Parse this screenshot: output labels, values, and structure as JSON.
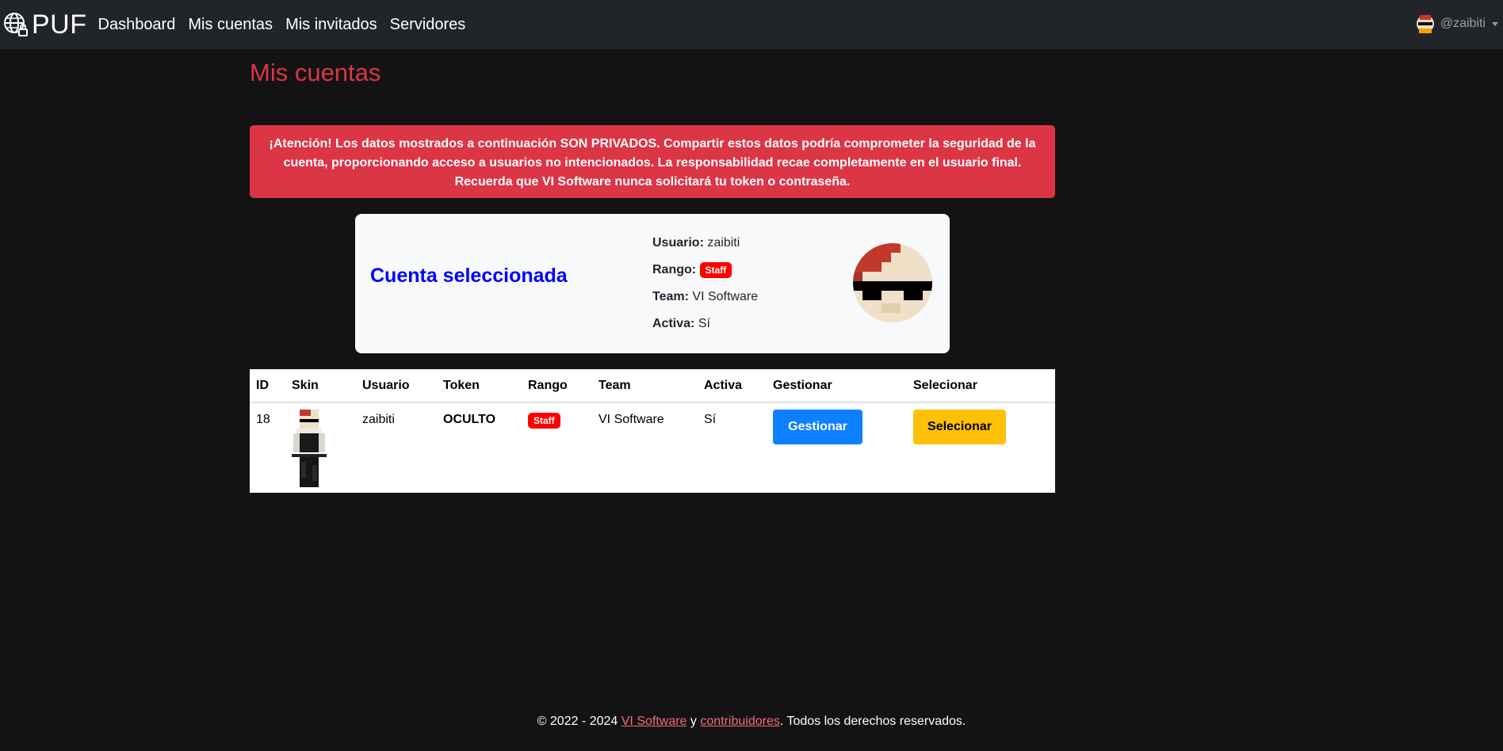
{
  "navbar": {
    "brand": "PUF",
    "links": [
      "Dashboard",
      "Mis cuentas",
      "Mis invitados",
      "Servidores"
    ],
    "user": "@zaibiti"
  },
  "page": {
    "title": "Mis cuentas"
  },
  "alert": {
    "strong": "¡Atención!",
    "text": " Los datos mostrados a continuación SON PRIVADOS. Compartir estos datos podría comprometer la seguridad de la cuenta, proporcionando acceso a usuarios no intencionados. La responsabilidad recae completamente en el usuario final. Recuerda que VI Software nunca solicitará tu token o contraseña."
  },
  "selected": {
    "title": "Cuenta seleccionada",
    "usuario_label": "Usuario:",
    "usuario": "zaibiti",
    "rango_label": "Rango:",
    "rango": "Staff",
    "team_label": "Team:",
    "team": "VI Software",
    "activa_label": "Activa:",
    "activa": "Sí"
  },
  "table": {
    "headers": [
      "ID",
      "Skin",
      "Usuario",
      "Token",
      "Rango",
      "Team",
      "Activa",
      "Gestionar",
      "Selecionar"
    ],
    "rows": [
      {
        "id": "18",
        "usuario": "zaibiti",
        "token": "OCULTO",
        "rango": "Staff",
        "team": "VI Software",
        "activa": "Sí",
        "gestionar": "Gestionar",
        "selecionar": "Selecionar"
      }
    ]
  },
  "footer": {
    "prefix": "© 2022 - 2024 ",
    "link1": "VI Software",
    "middle": " y ",
    "link2": "contribuidores",
    "suffix": ". Todos los derechos reservados."
  },
  "colors": {
    "navbar": "#212529",
    "background": "#131313",
    "danger": "#dc3545",
    "primary": "#0d80ff",
    "warning": "#ffc107",
    "badge": "#ff0000",
    "card_title": "#0000ff"
  }
}
